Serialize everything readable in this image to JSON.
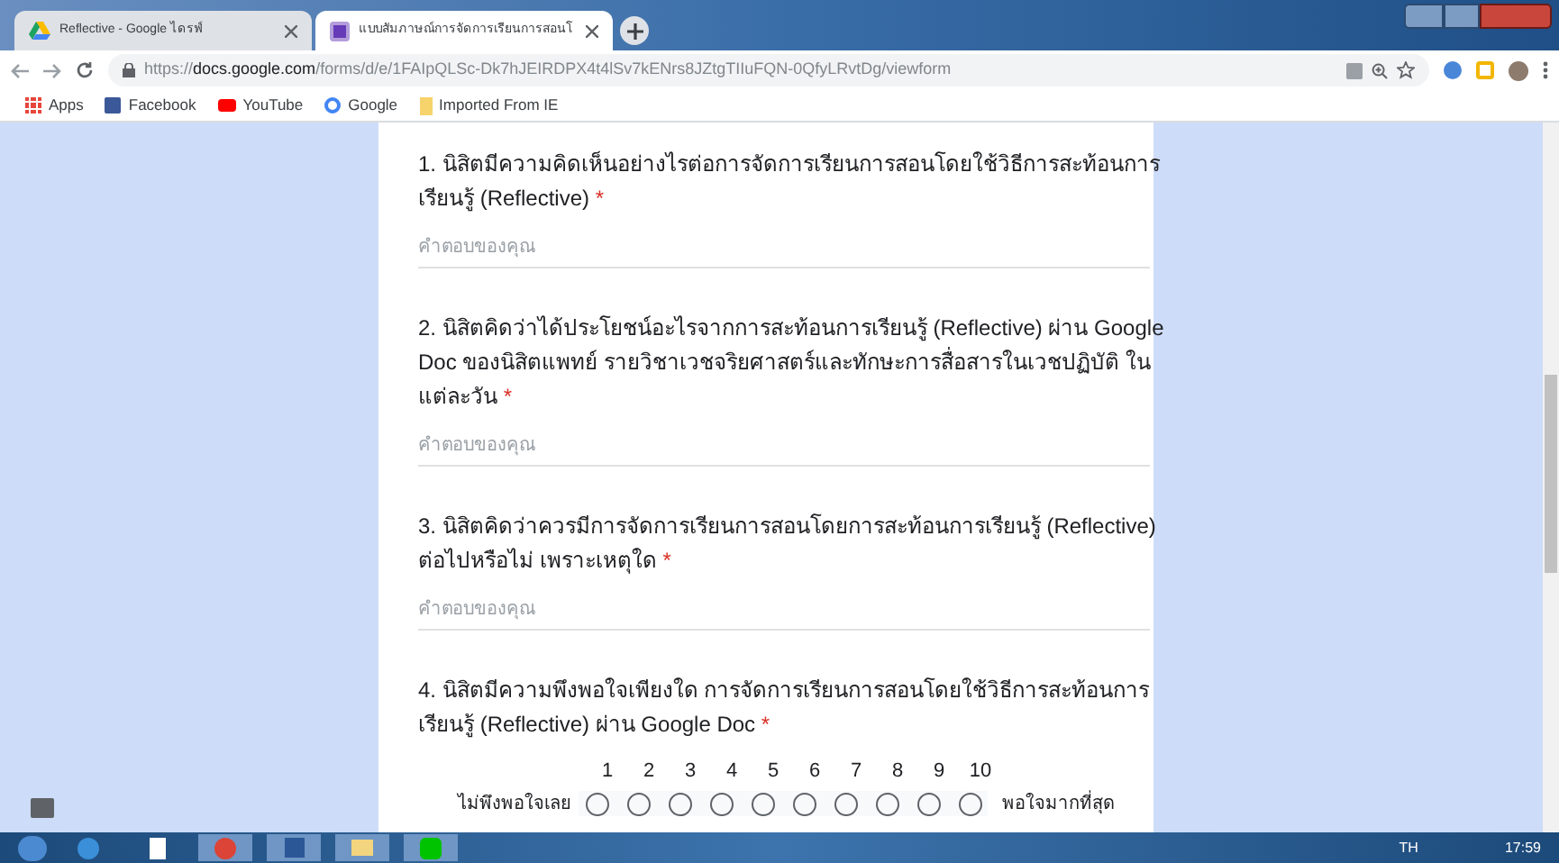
{
  "browser": {
    "tabs": [
      {
        "title": "Reflective - Google ไดรฟ์",
        "selected": false
      },
      {
        "title": "แบบสัมภาษณ์การจัดการเรียนการสอนโ",
        "selected": true
      }
    ],
    "url": {
      "scheme": "https://",
      "host": "docs.google.com",
      "path": "/forms/d/e/1FAIpQLSc-Dk7hJEIRDPX4t4lSv7kENrs8JZtgTIIuFQN-0QfyLRvtDg/viewform"
    },
    "bookmarks": [
      "Apps",
      "Facebook",
      "YouTube",
      "Google",
      "Imported From IE"
    ]
  },
  "questions": [
    {
      "kind": "text",
      "number": "1.",
      "title": "นิสิตมีความคิดเห็นอย่างไรต่อการจัดการเรียนการสอนโดยใช้วิธีการสะท้อนการเรียนรู้ (Reflective)",
      "required_mark": "*",
      "placeholder": "คำตอบของคุณ"
    },
    {
      "kind": "text",
      "number": "2.",
      "title": "นิสิตคิดว่าได้ประโยชน์อะไรจากการสะท้อนการเรียนรู้ (Reflective) ผ่าน Google Doc ของนิสิตแพทย์ รายวิชาเวชจริยศาสตร์และทักษะการสื่อสารในเวชปฏิบัติ ในแต่ละวัน",
      "required_mark": "*",
      "placeholder": "คำตอบของคุณ"
    },
    {
      "kind": "text",
      "number": "3.",
      "title": "นิสิตคิดว่าควรมีการจัดการเรียนการสอนโดยการสะท้อนการเรียนรู้ (Reflective) ต่อไปหรือไม่ เพราะเหตุใด",
      "required_mark": "*",
      "placeholder": "คำตอบของคุณ"
    },
    {
      "kind": "scale",
      "number": "4.",
      "title": "นิสิตมีความพึงพอใจเพียงใด การจัดการเรียนการสอนโดยใช้วิธีการสะท้อนการเรียนรู้ (Reflective) ผ่าน Google Doc",
      "required_mark": "*",
      "low_label": "ไม่พึงพอใจเลย",
      "high_label": "พอใจมากที่สุด",
      "options": [
        {
          "label": "1",
          "selected": false
        },
        {
          "label": "2",
          "selected": false
        },
        {
          "label": "3",
          "selected": false
        },
        {
          "label": "4",
          "selected": false
        },
        {
          "label": "5",
          "selected": false
        },
        {
          "label": "6",
          "selected": false
        },
        {
          "label": "7",
          "selected": false
        },
        {
          "label": "8",
          "selected": false
        },
        {
          "label": "9",
          "selected": false
        },
        {
          "label": "10",
          "selected": false
        }
      ]
    }
  ],
  "taskbar": {
    "language": "TH",
    "time": "17:59"
  }
}
